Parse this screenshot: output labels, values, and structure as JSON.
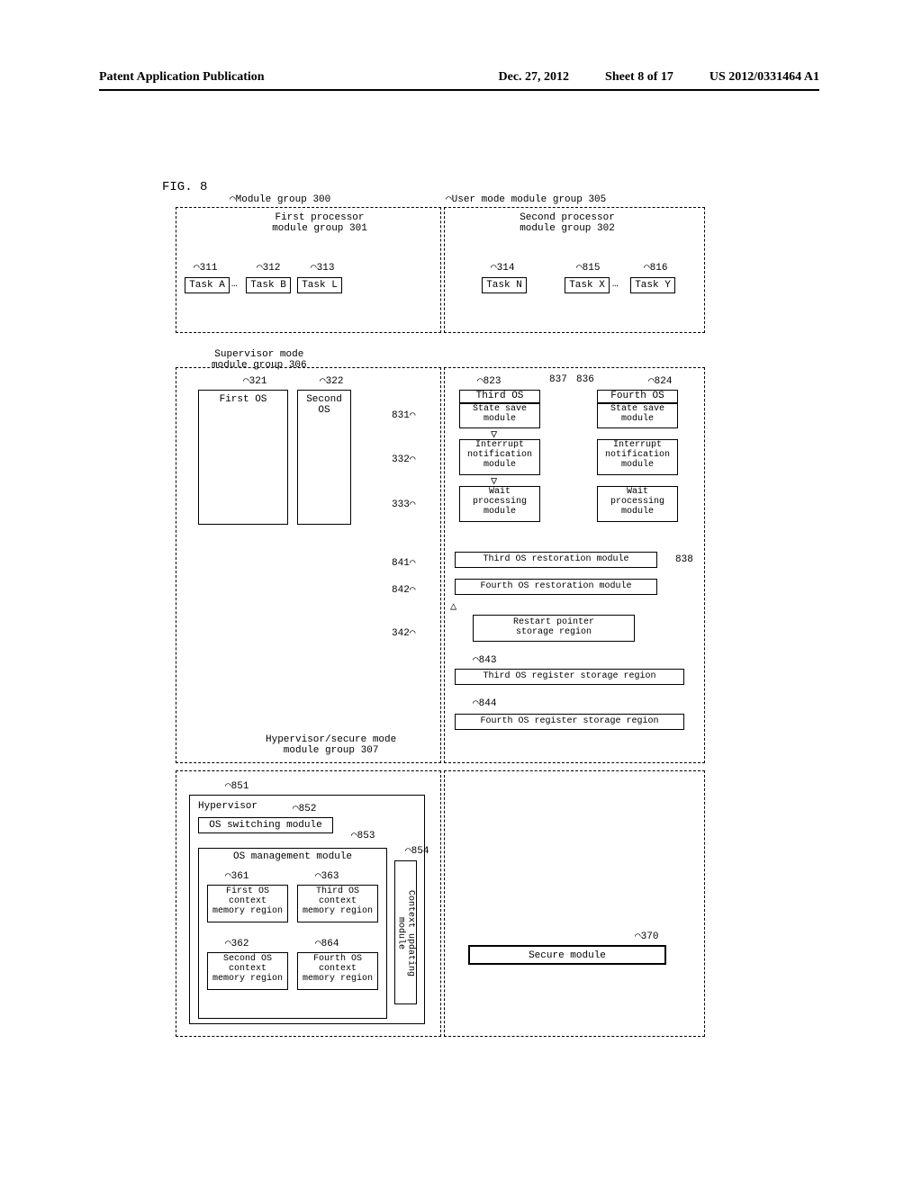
{
  "header": {
    "publication": "Patent Application Publication",
    "date": "Dec. 27, 2012",
    "sheet": "Sheet 8 of 17",
    "pubno": "US 2012/0331464 A1"
  },
  "figLabel": "FIG. 8",
  "groups": {
    "main": {
      "label": "Module group 300"
    },
    "userMode": {
      "label": "User mode module group 305"
    },
    "firstProc": {
      "label": "First processor\nmodule group 301"
    },
    "secondProc": {
      "label": "Second processor\nmodule group 302"
    },
    "supervisor": {
      "label": "Supervisor mode\nmodule group 306"
    },
    "hypervisor": {
      "label": "Hypervisor/secure mode\nmodule group 307"
    }
  },
  "tasks": {
    "a": {
      "ref": "311",
      "label": "Task A"
    },
    "b": {
      "ref": "312",
      "label": "Task B"
    },
    "l": {
      "ref": "313",
      "label": "Task L"
    },
    "n": {
      "ref": "314",
      "label": "Task N"
    },
    "x": {
      "ref": "815",
      "label": "Task X"
    },
    "y": {
      "ref": "816",
      "label": "Task Y"
    }
  },
  "os": {
    "first": {
      "ref": "321",
      "label": "First OS"
    },
    "second": {
      "ref": "322",
      "label": "Second\nOS"
    },
    "third": {
      "ref": "823",
      "label": "Third OS"
    },
    "fourth": {
      "ref": "824",
      "label": "Fourth OS"
    }
  },
  "refs": {
    "r837": "837",
    "r836": "836"
  },
  "modules": {
    "stateSave3": {
      "ref": "831",
      "label": "State save\nmodule"
    },
    "stateSave4": {
      "label": "State save\nmodule"
    },
    "interrupt3": {
      "ref": "332",
      "label": "Interrupt\nnotification\nmodule"
    },
    "interrupt4": {
      "label": "Interrupt\nnotification\nmodule"
    },
    "wait3": {
      "ref": "333",
      "label": "Wait\nprocessing\nmodule"
    },
    "wait4": {
      "label": "Wait\nprocessing\nmodule"
    },
    "restore3": {
      "ref": "841",
      "label": "Third OS restoration module"
    },
    "restore4": {
      "ref": "842",
      "label": "Fourth OS restoration module"
    },
    "restartPtr": {
      "ref": "342",
      "label": "Restart pointer\nstorage region"
    },
    "reg3": {
      "ref": "843",
      "label": "Third OS register storage region"
    },
    "reg4": {
      "ref": "844",
      "label": "Fourth OS register storage region"
    },
    "refBox838": "838"
  },
  "hyper": {
    "main": {
      "ref": "851",
      "label": "Hypervisor"
    },
    "switching": {
      "ref": "852",
      "label": "OS switching module"
    },
    "mgmt": {
      "ref": "853",
      "label": "OS management module"
    },
    "ctx1": {
      "ref": "361",
      "label": "First OS\ncontext\nmemory region"
    },
    "ctx2": {
      "ref": "362",
      "label": "Second OS\ncontext\nmemory region"
    },
    "ctx3": {
      "ref": "363",
      "label": "Third OS\ncontext\nmemory region"
    },
    "ctx4": {
      "ref": "864",
      "label": "Fourth OS\ncontext\nmemory region"
    },
    "updating": {
      "ref": "854",
      "label": "Context updating\nmodule"
    }
  },
  "secure": {
    "ref": "370",
    "label": "Secure module"
  },
  "ellipsis": "…"
}
